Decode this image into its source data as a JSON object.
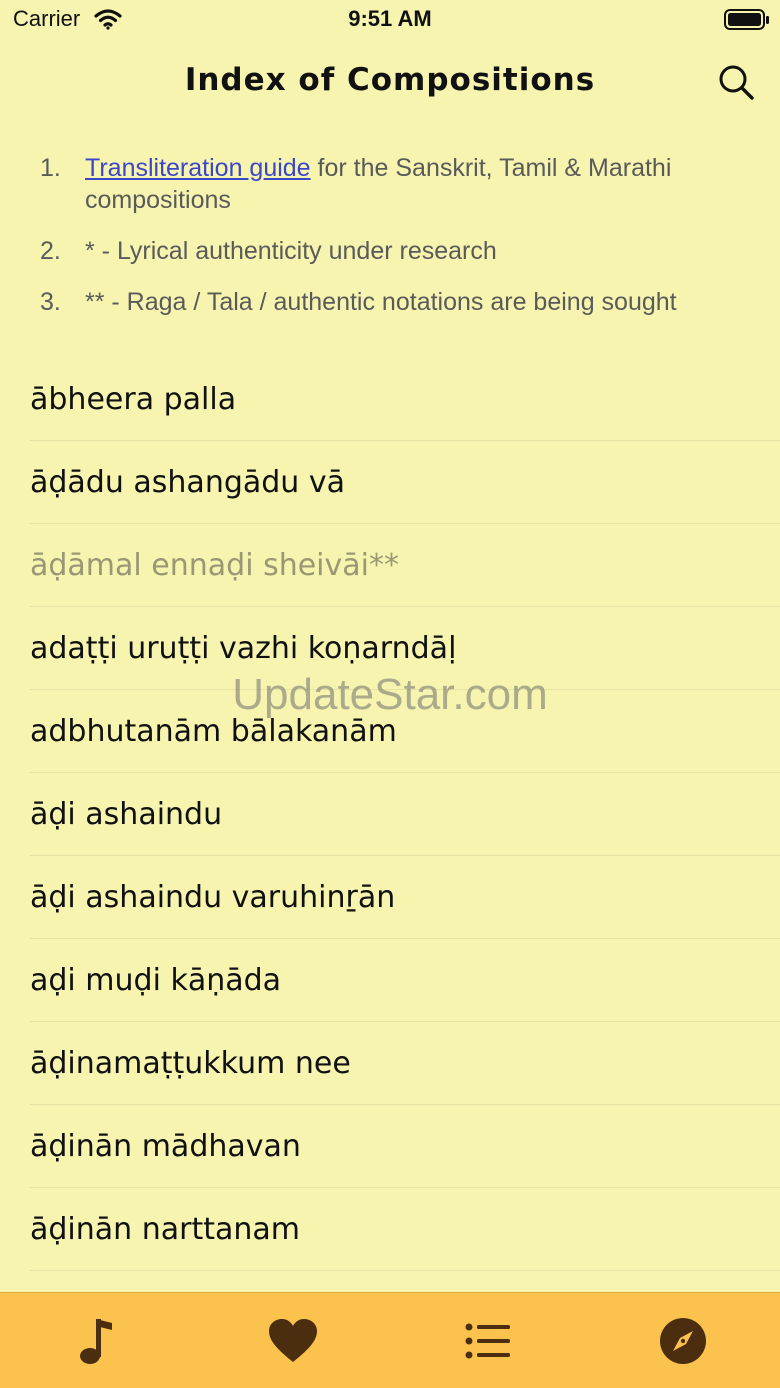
{
  "status_bar": {
    "carrier": "Carrier",
    "time": "9:51 AM"
  },
  "header": {
    "title": "Index of Compositions",
    "search_icon": "search-icon"
  },
  "notes": [
    {
      "number": "1.",
      "link_text": "Transliteration guide",
      "text": " for the Sanskrit, Tamil & Marathi compositions"
    },
    {
      "number": "2.",
      "text": "* - Lyrical authenticity under research"
    },
    {
      "number": "3.",
      "text": "** - Raga / Tala / authentic notations are being sought"
    }
  ],
  "compositions": [
    {
      "title": "ābheera palla"
    },
    {
      "title": "āḍādu ashangādu vā"
    },
    {
      "title": "āḍāmal ennaḍi sheivāi**"
    },
    {
      "title": "adaṭṭi uruṭṭi vazhi koṇarndāḷ"
    },
    {
      "title": "adbhutanām bālakanām"
    },
    {
      "title": "āḍi ashaindu"
    },
    {
      "title": "āḍi ashaindu varuhinṟān"
    },
    {
      "title": "aḍi muḍi kāṇāda"
    },
    {
      "title": "āḍinamaṭṭukkum nee"
    },
    {
      "title": "āḍinān mādhavan"
    },
    {
      "title": "āḍinān narttanam"
    }
  ],
  "watermark": "UpdateStar.com",
  "tab_bar": {
    "tabs": [
      "music-note-icon",
      "heart-icon",
      "list-icon",
      "compass-icon"
    ],
    "background": "#fcc24e",
    "icon_color": "#4a2e0f"
  }
}
